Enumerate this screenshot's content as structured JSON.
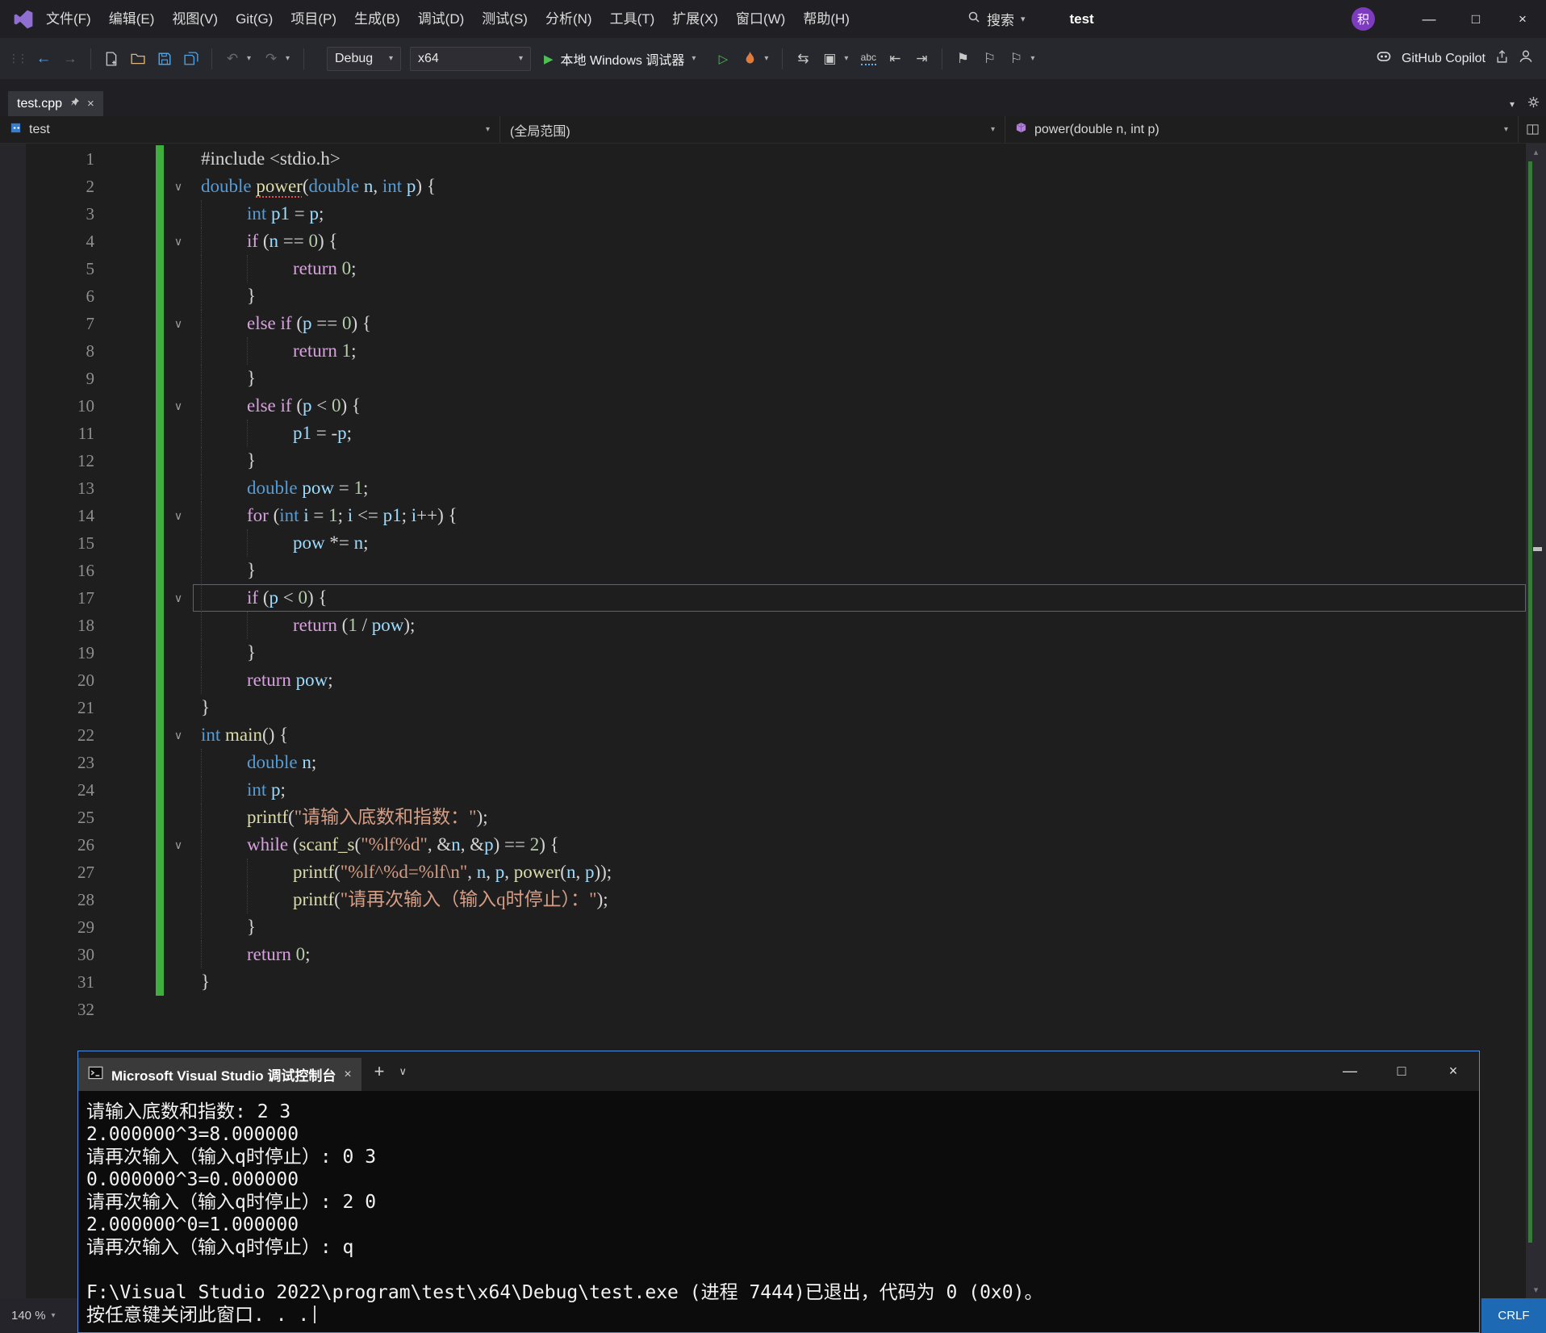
{
  "titlebar": {
    "menus": [
      "文件(F)",
      "编辑(E)",
      "视图(V)",
      "Git(G)",
      "项目(P)",
      "生成(B)",
      "调试(D)",
      "测试(S)",
      "分析(N)",
      "工具(T)",
      "扩展(X)",
      "窗口(W)",
      "帮助(H)"
    ],
    "search_label": "搜索",
    "window_title": "test",
    "avatar_initial": "积"
  },
  "icons": {
    "gripper": "⋮⋮",
    "back": "←",
    "forward": "→",
    "undo": "↶",
    "redo": "↷",
    "caret": "▾",
    "play": "▶",
    "play_outline": "▷",
    "sync": "⇆",
    "frame": "▣",
    "outdent": "⇤",
    "indent": "⇥",
    "bookmark": "⚑",
    "bookmark_alt": "⚐",
    "chevron_down": "∨",
    "scroll_up": "▴",
    "scroll_down": "▾",
    "minimize": "—",
    "maximize": "□",
    "close": "×",
    "plus": "+"
  },
  "toolbar": {
    "config": "Debug",
    "platform": "x64",
    "run_label": "本地 Windows 调试器",
    "abc_label": "abc",
    "copilot_label": "GitHub Copilot"
  },
  "tabs": {
    "active_label": "test.cpp"
  },
  "navbar": {
    "project": "test",
    "scope": "(全局范围)",
    "member": "power(double n, int p)"
  },
  "editor": {
    "lines": [
      {
        "n": 1,
        "ind": 0,
        "t": [
          [
            "plain",
            "#include <stdio.h>"
          ]
        ]
      },
      {
        "n": 2,
        "ind": 0,
        "fold": true,
        "t": [
          [
            "kw",
            "double"
          ],
          [
            "plain",
            " "
          ],
          [
            "fnsq",
            "power"
          ],
          [
            "plain",
            "("
          ],
          [
            "kw",
            "double"
          ],
          [
            "plain",
            " "
          ],
          [
            "var",
            "n"
          ],
          [
            "plain",
            ", "
          ],
          [
            "kw",
            "int"
          ],
          [
            "plain",
            " "
          ],
          [
            "var",
            "p"
          ],
          [
            "plain",
            ") {"
          ]
        ]
      },
      {
        "n": 3,
        "ind": 1,
        "t": [
          [
            "kw",
            "int"
          ],
          [
            "plain",
            " "
          ],
          [
            "var",
            "p1"
          ],
          [
            "plain",
            " = "
          ],
          [
            "var",
            "p"
          ],
          [
            "plain",
            ";"
          ]
        ]
      },
      {
        "n": 4,
        "ind": 1,
        "fold": true,
        "t": [
          [
            "ctrl",
            "if"
          ],
          [
            "plain",
            " ("
          ],
          [
            "var",
            "n"
          ],
          [
            "plain",
            " == "
          ],
          [
            "num",
            "0"
          ],
          [
            "plain",
            ") {"
          ]
        ]
      },
      {
        "n": 5,
        "ind": 2,
        "t": [
          [
            "ctrl",
            "return"
          ],
          [
            "plain",
            " "
          ],
          [
            "num",
            "0"
          ],
          [
            "plain",
            ";"
          ]
        ]
      },
      {
        "n": 6,
        "ind": 1,
        "t": [
          [
            "plain",
            "}"
          ]
        ]
      },
      {
        "n": 7,
        "ind": 1,
        "fold": true,
        "t": [
          [
            "ctrl",
            "else"
          ],
          [
            "plain",
            " "
          ],
          [
            "ctrl",
            "if"
          ],
          [
            "plain",
            " ("
          ],
          [
            "var",
            "p"
          ],
          [
            "plain",
            " == "
          ],
          [
            "num",
            "0"
          ],
          [
            "plain",
            ") {"
          ]
        ]
      },
      {
        "n": 8,
        "ind": 2,
        "t": [
          [
            "ctrl",
            "return"
          ],
          [
            "plain",
            " "
          ],
          [
            "num",
            "1"
          ],
          [
            "plain",
            ";"
          ]
        ]
      },
      {
        "n": 9,
        "ind": 1,
        "t": [
          [
            "plain",
            "}"
          ]
        ]
      },
      {
        "n": 10,
        "ind": 1,
        "fold": true,
        "t": [
          [
            "ctrl",
            "else"
          ],
          [
            "plain",
            " "
          ],
          [
            "ctrl",
            "if"
          ],
          [
            "plain",
            " ("
          ],
          [
            "var",
            "p"
          ],
          [
            "plain",
            " < "
          ],
          [
            "num",
            "0"
          ],
          [
            "plain",
            ") {"
          ]
        ]
      },
      {
        "n": 11,
        "ind": 2,
        "t": [
          [
            "var",
            "p1"
          ],
          [
            "plain",
            " = -"
          ],
          [
            "var",
            "p"
          ],
          [
            "plain",
            ";"
          ]
        ]
      },
      {
        "n": 12,
        "ind": 1,
        "t": [
          [
            "plain",
            "}"
          ]
        ]
      },
      {
        "n": 13,
        "ind": 1,
        "t": [
          [
            "kw",
            "double"
          ],
          [
            "plain",
            " "
          ],
          [
            "var",
            "pow"
          ],
          [
            "plain",
            " = "
          ],
          [
            "num",
            "1"
          ],
          [
            "plain",
            ";"
          ]
        ]
      },
      {
        "n": 14,
        "ind": 1,
        "fold": true,
        "t": [
          [
            "ctrl",
            "for"
          ],
          [
            "plain",
            " ("
          ],
          [
            "kw",
            "int"
          ],
          [
            "plain",
            " "
          ],
          [
            "var",
            "i"
          ],
          [
            "plain",
            " = "
          ],
          [
            "num",
            "1"
          ],
          [
            "plain",
            "; "
          ],
          [
            "var",
            "i"
          ],
          [
            "plain",
            " <= "
          ],
          [
            "var",
            "p1"
          ],
          [
            "plain",
            "; "
          ],
          [
            "var",
            "i"
          ],
          [
            "plain",
            "++) {"
          ]
        ]
      },
      {
        "n": 15,
        "ind": 2,
        "t": [
          [
            "var",
            "pow"
          ],
          [
            "plain",
            " *= "
          ],
          [
            "var",
            "n"
          ],
          [
            "plain",
            ";"
          ]
        ]
      },
      {
        "n": 16,
        "ind": 1,
        "t": [
          [
            "plain",
            "}"
          ]
        ]
      },
      {
        "n": 17,
        "ind": 1,
        "fold": true,
        "cur": true,
        "t": [
          [
            "ctrl",
            "if"
          ],
          [
            "plain",
            " ("
          ],
          [
            "var",
            "p"
          ],
          [
            "plain",
            " < "
          ],
          [
            "num",
            "0"
          ],
          [
            "plain",
            ") {"
          ]
        ]
      },
      {
        "n": 18,
        "ind": 2,
        "t": [
          [
            "ctrl",
            "return"
          ],
          [
            "plain",
            " ("
          ],
          [
            "num",
            "1"
          ],
          [
            "plain",
            " / "
          ],
          [
            "var",
            "pow"
          ],
          [
            "plain",
            ");"
          ]
        ]
      },
      {
        "n": 19,
        "ind": 1,
        "t": [
          [
            "plain",
            "}"
          ]
        ]
      },
      {
        "n": 20,
        "ind": 1,
        "t": [
          [
            "ctrl",
            "return"
          ],
          [
            "plain",
            " "
          ],
          [
            "var",
            "pow"
          ],
          [
            "plain",
            ";"
          ]
        ]
      },
      {
        "n": 21,
        "ind": 0,
        "t": [
          [
            "plain",
            "}"
          ]
        ]
      },
      {
        "n": 22,
        "ind": 0,
        "fold": true,
        "t": [
          [
            "kw",
            "int"
          ],
          [
            "plain",
            " "
          ],
          [
            "fn",
            "main"
          ],
          [
            "plain",
            "() {"
          ]
        ]
      },
      {
        "n": 23,
        "ind": 1,
        "t": [
          [
            "kw",
            "double"
          ],
          [
            "plain",
            " "
          ],
          [
            "var",
            "n"
          ],
          [
            "plain",
            ";"
          ]
        ]
      },
      {
        "n": 24,
        "ind": 1,
        "t": [
          [
            "kw",
            "int"
          ],
          [
            "plain",
            " "
          ],
          [
            "var",
            "p"
          ],
          [
            "plain",
            ";"
          ]
        ]
      },
      {
        "n": 25,
        "ind": 1,
        "t": [
          [
            "fn",
            "printf"
          ],
          [
            "plain",
            "("
          ],
          [
            "str",
            "\"请输入底数和指数：\""
          ],
          [
            "plain",
            ");"
          ]
        ]
      },
      {
        "n": 26,
        "ind": 1,
        "fold": true,
        "t": [
          [
            "ctrl",
            "while"
          ],
          [
            "plain",
            " ("
          ],
          [
            "fn",
            "scanf_s"
          ],
          [
            "plain",
            "("
          ],
          [
            "str",
            "\"%lf%d\""
          ],
          [
            "plain",
            ", &"
          ],
          [
            "var",
            "n"
          ],
          [
            "plain",
            ", &"
          ],
          [
            "var",
            "p"
          ],
          [
            "plain",
            ") == "
          ],
          [
            "num",
            "2"
          ],
          [
            "plain",
            ") {"
          ]
        ]
      },
      {
        "n": 27,
        "ind": 2,
        "t": [
          [
            "fn",
            "printf"
          ],
          [
            "plain",
            "("
          ],
          [
            "str",
            "\"%lf^%d=%lf\\n\""
          ],
          [
            "plain",
            ", "
          ],
          [
            "var",
            "n"
          ],
          [
            "plain",
            ", "
          ],
          [
            "var",
            "p"
          ],
          [
            "plain",
            ", "
          ],
          [
            "fn",
            "power"
          ],
          [
            "plain",
            "("
          ],
          [
            "var",
            "n"
          ],
          [
            "plain",
            ", "
          ],
          [
            "var",
            "p"
          ],
          [
            "plain",
            "));"
          ]
        ]
      },
      {
        "n": 28,
        "ind": 2,
        "t": [
          [
            "fn",
            "printf"
          ],
          [
            "plain",
            "("
          ],
          [
            "str",
            "\"请再次输入（输入q时停止）：\""
          ],
          [
            "plain",
            ");"
          ]
        ]
      },
      {
        "n": 29,
        "ind": 1,
        "t": [
          [
            "plain",
            "}"
          ]
        ]
      },
      {
        "n": 30,
        "ind": 1,
        "t": [
          [
            "ctrl",
            "return"
          ],
          [
            "plain",
            " "
          ],
          [
            "num",
            "0"
          ],
          [
            "plain",
            ";"
          ]
        ]
      },
      {
        "n": 31,
        "ind": 0,
        "t": [
          [
            "plain",
            "}"
          ]
        ]
      },
      {
        "n": 32,
        "ind": 0,
        "t": []
      }
    ]
  },
  "statusbar": {
    "zoom": "140 %",
    "eol": "CRLF"
  },
  "console": {
    "title": "Microsoft Visual Studio 调试控制台",
    "lines": [
      "请输入底数和指数: 2 3",
      "2.000000^3=8.000000",
      "请再次输入（输入q时停止）: 0 3",
      "0.000000^3=0.000000",
      "请再次输入（输入q时停止）: 2 0",
      "2.000000^0=1.000000",
      "请再次输入（输入q时停止）: q",
      "",
      "F:\\Visual Studio 2022\\program\\test\\x64\\Debug\\test.exe (进程 7444)已退出，代码为 0 (0x0)。",
      "按任意键关闭此窗口. . ."
    ]
  }
}
